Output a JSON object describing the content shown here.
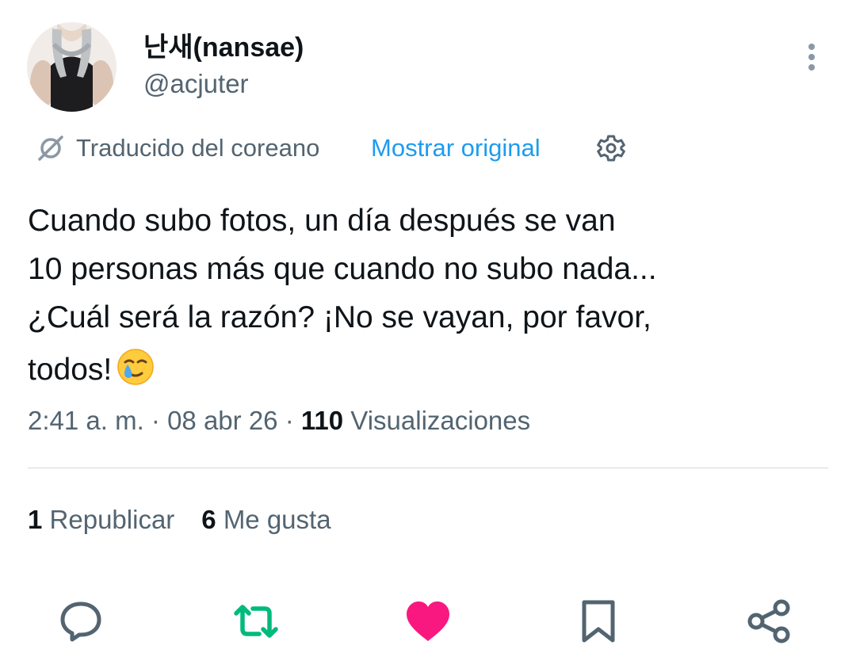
{
  "author": {
    "display_name": "난새(nansae)",
    "handle": "@acjuter",
    "avatar_icon": "avatar-photo"
  },
  "header": {
    "more_icon": "more-vertical-icon"
  },
  "translation": {
    "icon": "translate-icon",
    "label": "Traducido del coreano",
    "show_original": "Mostrar original",
    "settings_icon": "gear-icon"
  },
  "tweet": {
    "lines": [
      "Cuando subo fotos, un día después se van",
      "10 personas más que cuando no subo nada...",
      "¿Cuál será la razón? ¡No se vayan, por favor,",
      "todos!"
    ],
    "emoji": "smiling-face-with-tear-emoji"
  },
  "meta": {
    "time": "2:41 a. m.",
    "separator": " · ",
    "date": "08 abr 26",
    "views_count": "110",
    "views_label": "Visualizaciones"
  },
  "stats": {
    "reposts_count": "1",
    "reposts_label": "Republicar",
    "likes_count": "6",
    "likes_label": "Me gusta"
  },
  "actions": {
    "reply_icon": "reply-icon",
    "repost_icon": "repost-icon",
    "like_icon": "heart-icon",
    "bookmark_icon": "bookmark-icon",
    "share_icon": "share-icon"
  },
  "colors": {
    "text_primary": "#0f1419",
    "text_secondary": "#536471",
    "link_blue": "#1d9bf0",
    "repost_green": "#00ba7c",
    "like_pink": "#f91880",
    "divider": "#cfd9de"
  }
}
